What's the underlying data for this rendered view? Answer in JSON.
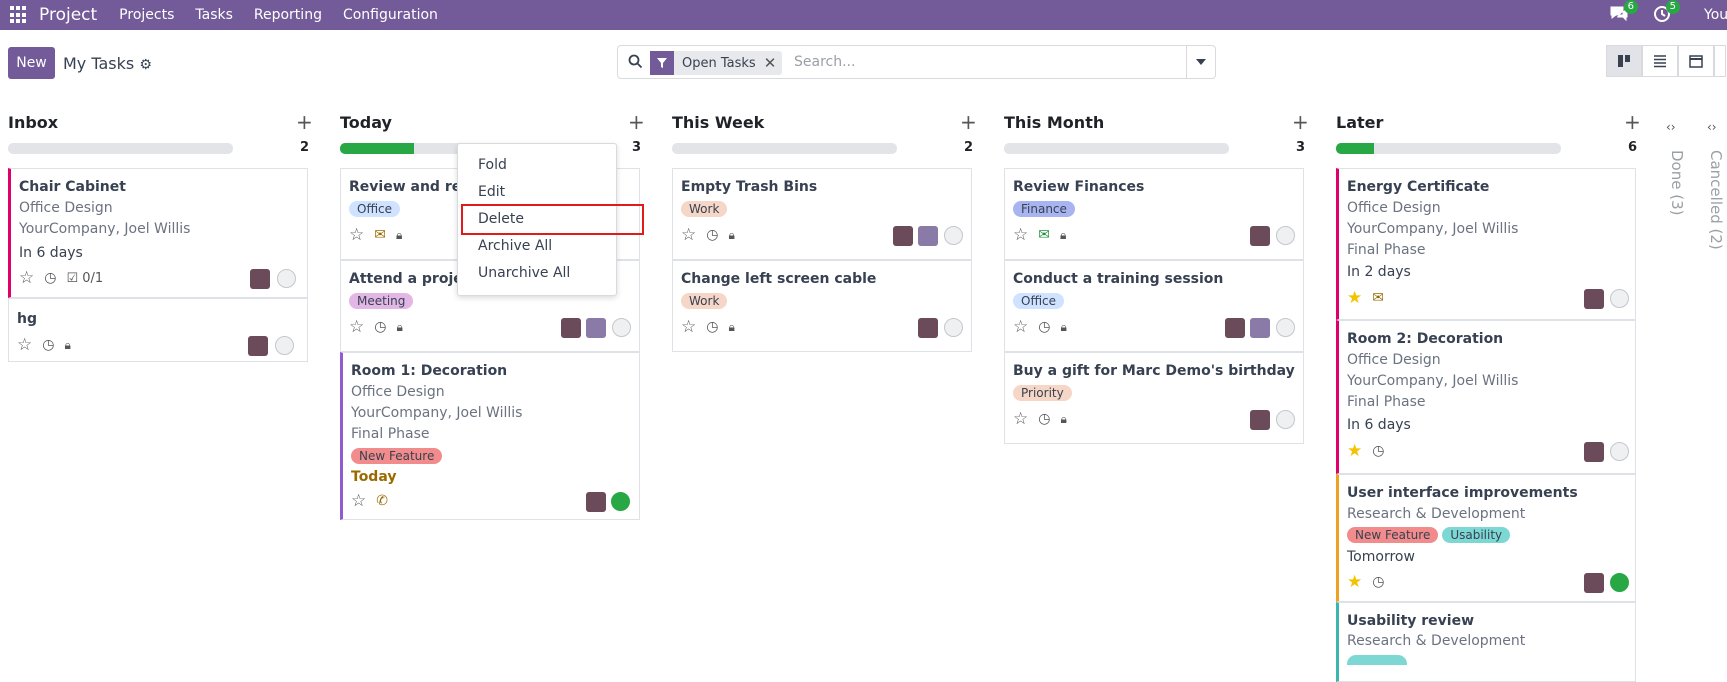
{
  "topbar": {
    "app": "Project",
    "menu": [
      "Projects",
      "Tasks",
      "Reporting",
      "Configuration"
    ],
    "msg_count": "6",
    "activity_count": "5",
    "user": "Your"
  },
  "control": {
    "new_label": "New",
    "title": "My Tasks",
    "facet": "Open Tasks",
    "search_placeholder": "Search..."
  },
  "columns": [
    {
      "title": "Inbox",
      "count": "2",
      "progress": 0
    },
    {
      "title": "Today",
      "count": "3",
      "progress": 0.33
    },
    {
      "title": "This Week",
      "count": "2",
      "progress": 0
    },
    {
      "title": "This Month",
      "count": "3",
      "progress": 0
    },
    {
      "title": "Later",
      "count": "6",
      "progress": 0.17
    }
  ],
  "folded": [
    "Done (3)",
    "Cancelled (2)"
  ],
  "inbox": [
    {
      "title": "Chair Cabinet",
      "project": "Office Design",
      "customer": "YourCompany, Joel Willis",
      "deadline": "In 6 days",
      "subtasks": "0/1"
    },
    {
      "title": "hg"
    }
  ],
  "today": [
    {
      "title": "Review and rep",
      "tag": "Office"
    },
    {
      "title": "Attend a projec",
      "tag": "Meeting"
    },
    {
      "title": "Room 1: Decoration",
      "project": "Office Design",
      "customer": "YourCompany, Joel Willis",
      "stage": "Final Phase",
      "tag": "New Feature",
      "deadline": "Today"
    }
  ],
  "week": [
    {
      "title": "Empty Trash Bins",
      "tag": "Work"
    },
    {
      "title": "Change left screen cable",
      "tag": "Work"
    }
  ],
  "month": [
    {
      "title": "Review Finances",
      "tag": "Finance"
    },
    {
      "title": "Conduct a training session",
      "tag": "Office"
    },
    {
      "title": "Buy a gift for Marc Demo's birthday",
      "tag": "Priority"
    }
  ],
  "later": [
    {
      "title": "Energy Certificate",
      "project": "Office Design",
      "customer": "YourCompany, Joel Willis",
      "stage": "Final Phase",
      "deadline": "In 2 days"
    },
    {
      "title": "Room 2: Decoration",
      "project": "Office Design",
      "customer": "YourCompany, Joel Willis",
      "stage": "Final Phase",
      "deadline": "In 6 days"
    },
    {
      "title": "User interface improvements",
      "project": "Research & Development",
      "tag1": "New Feature",
      "tag2": "Usability",
      "deadline": "Tomorrow"
    },
    {
      "title": "Usability review",
      "project": "Research & Development"
    }
  ],
  "dropdown": [
    "Fold",
    "Edit",
    "Delete",
    "Archive All",
    "Unarchive All"
  ],
  "colors": {
    "brand": "#735a98",
    "progress": "#28a745",
    "highlight": "#e01b1b"
  }
}
